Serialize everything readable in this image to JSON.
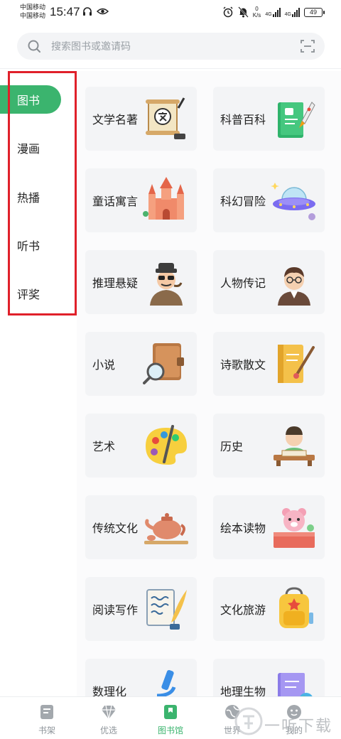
{
  "status_bar": {
    "carrier_1": "中国移动",
    "carrier_2": "中国移动",
    "time": "15:47",
    "speed_value": "0",
    "speed_unit": "K/s",
    "network_1": "4G",
    "network_2": "4G",
    "battery": "49"
  },
  "search": {
    "placeholder": "搜索图书或邀请码"
  },
  "sidebar": {
    "items": [
      {
        "label": "图书",
        "active": true
      },
      {
        "label": "漫画",
        "active": false
      },
      {
        "label": "热播",
        "active": false
      },
      {
        "label": "听书",
        "active": false
      },
      {
        "label": "评奖",
        "active": false
      }
    ]
  },
  "categories": [
    {
      "label": "文学名著",
      "icon": "scroll-icon"
    },
    {
      "label": "科普百科",
      "icon": "rocket-book-icon"
    },
    {
      "label": "童话寓言",
      "icon": "castle-icon"
    },
    {
      "label": "科幻冒险",
      "icon": "ufo-icon"
    },
    {
      "label": "推理悬疑",
      "icon": "detective-icon"
    },
    {
      "label": "人物传记",
      "icon": "portrait-icon"
    },
    {
      "label": "小说",
      "icon": "book-magnifier-icon"
    },
    {
      "label": "诗歌散文",
      "icon": "notebook-brush-icon"
    },
    {
      "label": "艺术",
      "icon": "palette-icon"
    },
    {
      "label": "历史",
      "icon": "scholar-icon"
    },
    {
      "label": "传统文化",
      "icon": "teapot-icon"
    },
    {
      "label": "绘本读物",
      "icon": "teddy-bear-icon"
    },
    {
      "label": "阅读写作",
      "icon": "paper-quill-icon"
    },
    {
      "label": "文化旅游",
      "icon": "backpack-icon"
    },
    {
      "label": "数理化",
      "icon": "microscope-icon"
    },
    {
      "label": "地理生物",
      "icon": "globe-book-icon"
    }
  ],
  "bottom_nav": {
    "items": [
      {
        "label": "书架",
        "icon": "bookshelf-icon",
        "active": false
      },
      {
        "label": "优选",
        "icon": "diamond-icon",
        "active": false
      },
      {
        "label": "图书馆",
        "icon": "library-icon",
        "active": true
      },
      {
        "label": "世界",
        "icon": "world-icon",
        "active": false
      },
      {
        "label": "我的",
        "icon": "profile-icon",
        "active": false
      }
    ]
  },
  "watermark": {
    "text": "一听下载"
  },
  "colors": {
    "accent": "#3bb46e",
    "highlight_box": "#e0202a",
    "card_bg": "#f3f4f6"
  }
}
